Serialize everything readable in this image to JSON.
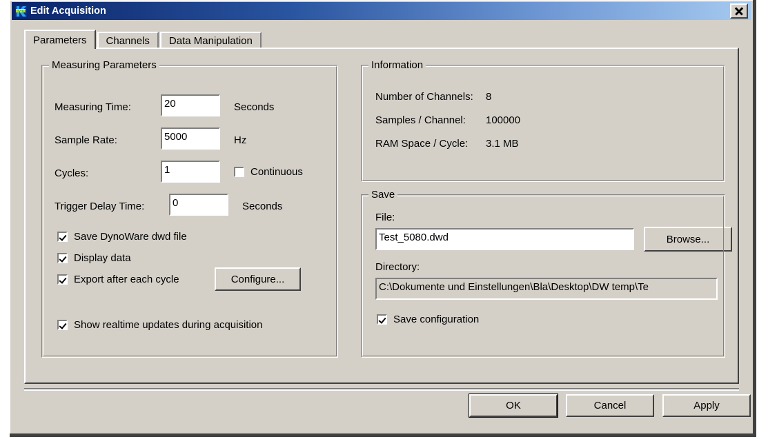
{
  "window": {
    "title": "Edit Acquisition",
    "icon": "dynoware-icon",
    "close_label": "Close"
  },
  "tabs": [
    {
      "label": "Parameters",
      "active": true
    },
    {
      "label": "Channels",
      "active": false
    },
    {
      "label": "Data Manipulation",
      "active": false
    }
  ],
  "measuring_parameters": {
    "title": "Measuring Parameters",
    "fields": [
      {
        "label": "Measuring Time:",
        "value": "20",
        "unit": "Seconds"
      },
      {
        "label": "Sample Rate:",
        "value": "5000",
        "unit": "Hz"
      },
      {
        "label": "Cycles:",
        "value": "1",
        "unit": ""
      },
      {
        "label": "Trigger Delay Time:",
        "value": "0",
        "unit": "Seconds"
      }
    ],
    "continuous": {
      "label": "Continuous",
      "checked": false
    },
    "checkboxes": [
      {
        "label": "Save DynoWare dwd file",
        "checked": true
      },
      {
        "label": "Display data",
        "checked": true
      },
      {
        "label": "Export after each cycle",
        "checked": true
      },
      {
        "label": "Show realtime updates during acquisition",
        "checked": true
      }
    ],
    "configure_button": "Configure..."
  },
  "information": {
    "title": "Information",
    "rows": [
      {
        "label": "Number of Channels:",
        "value": "8"
      },
      {
        "label": "Samples / Channel:",
        "value": "100000"
      },
      {
        "label": "RAM Space / Cycle:",
        "value": "3.1 MB"
      }
    ]
  },
  "save": {
    "title": "Save",
    "file_label": "File:",
    "file_value": "Test_5080.dwd",
    "file_placeholder": "",
    "browse_button": "Browse...",
    "directory_label": "Directory:",
    "directory_value": "C:\\Dokumente und Einstellungen\\Bla\\Desktop\\DW temp\\Te",
    "save_configuration": {
      "label": "Save configuration",
      "checked": true
    }
  },
  "footer": {
    "ok": "OK",
    "cancel": "Cancel",
    "apply": "Apply"
  },
  "colors": {
    "dialog_face": "#d4d0c8",
    "title_gradient_start": "#0a246a",
    "title_gradient_end": "#a6caf0",
    "field_background": "#ffffff",
    "text": "#000000"
  }
}
